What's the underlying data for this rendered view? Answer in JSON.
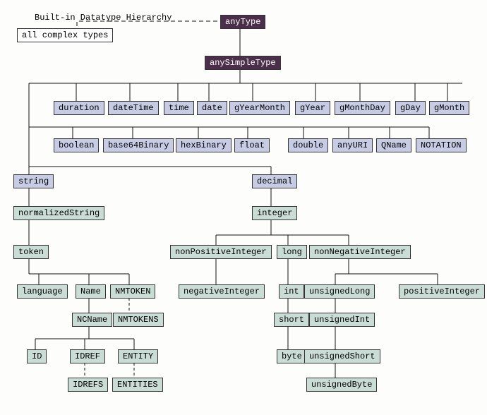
{
  "title": "Built-in Datatype Hierarchy",
  "nodes": {
    "anyType": "anyType",
    "allComplex": "all complex types",
    "anySimpleType": "anySimpleType",
    "duration": "duration",
    "dateTime": "dateTime",
    "time": "time",
    "date": "date",
    "gYearMonth": "gYearMonth",
    "gYear": "gYear",
    "gMonthDay": "gMonthDay",
    "gDay": "gDay",
    "gMonth": "gMonth",
    "boolean": "boolean",
    "base64Binary": "base64Binary",
    "hexBinary": "hexBinary",
    "float": "float",
    "double": "double",
    "anyURI": "anyURI",
    "QName": "QName",
    "NOTATION": "NOTATION",
    "string": "string",
    "decimal": "decimal",
    "normalizedString": "normalizedString",
    "integer": "integer",
    "token": "token",
    "nonPositiveInteger": "nonPositiveInteger",
    "long": "long",
    "nonNegativeInteger": "nonNegativeInteger",
    "language": "language",
    "Name": "Name",
    "NMTOKEN": "NMTOKEN",
    "negativeInteger": "negativeInteger",
    "int": "int",
    "unsignedLong": "unsignedLong",
    "positiveInteger": "positiveInteger",
    "NCName": "NCName",
    "NMTOKENS": "NMTOKENS",
    "short": "short",
    "unsignedInt": "unsignedInt",
    "ID": "ID",
    "IDREF": "IDREF",
    "ENTITY": "ENTITY",
    "byte": "byte",
    "unsignedShort": "unsignedShort",
    "IDREFS": "IDREFS",
    "ENTITIES": "ENTITIES",
    "unsignedByte": "unsignedByte"
  },
  "hierarchy": {
    "anyType": [
      "all complex types",
      "anySimpleType"
    ],
    "anySimpleType": [
      "duration",
      "dateTime",
      "time",
      "date",
      "gYearMonth",
      "gYear",
      "gMonthDay",
      "gDay",
      "gMonth",
      "boolean",
      "base64Binary",
      "hexBinary",
      "float",
      "double",
      "anyURI",
      "QName",
      "NOTATION",
      "string",
      "decimal"
    ],
    "string": [
      "normalizedString"
    ],
    "normalizedString": [
      "token"
    ],
    "token": [
      "language",
      "Name",
      "NMTOKEN"
    ],
    "Name": [
      "NCName"
    ],
    "NMTOKEN": [
      "NMTOKENS"
    ],
    "NCName": [
      "ID",
      "IDREF",
      "ENTITY"
    ],
    "IDREF": [
      "IDREFS"
    ],
    "ENTITY": [
      "ENTITIES"
    ],
    "decimal": [
      "integer"
    ],
    "integer": [
      "nonPositiveInteger",
      "long",
      "nonNegativeInteger"
    ],
    "nonPositiveInteger": [
      "negativeInteger"
    ],
    "long": [
      "int"
    ],
    "int": [
      "short"
    ],
    "short": [
      "byte"
    ],
    "nonNegativeInteger": [
      "unsignedLong",
      "positiveInteger"
    ],
    "unsignedLong": [
      "unsignedInt"
    ],
    "unsignedInt": [
      "unsignedShort"
    ],
    "unsignedShort": [
      "unsignedByte"
    ]
  }
}
